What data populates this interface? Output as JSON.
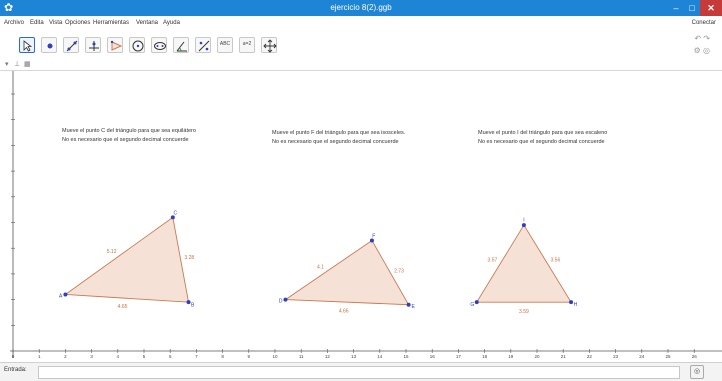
{
  "window": {
    "title": "ejercicio 8(2).ggb",
    "app_icon": "geogebra-icon",
    "minimize_label": "–",
    "maximize_label": "□",
    "close_label": "✕"
  },
  "menu": {
    "items": [
      "Archivo",
      "Edita",
      "Vista",
      "Opciones",
      "Herramientas",
      "Ventana",
      "Ayuda"
    ],
    "connect": "Conectar"
  },
  "toolbar": {
    "tools": [
      "move-tool",
      "point-tool",
      "line-tool",
      "perpendicular-tool",
      "polygon-tool",
      "circle-tool",
      "conic-tool",
      "angle-tool",
      "reflect-tool",
      "text-tool",
      "slider-tool",
      "move-view-tool"
    ],
    "text_tool_label": "ABC",
    "slider_tool_label": "a=2",
    "undo_label": "↶ ↷",
    "help_label": "⚙ ◎"
  },
  "graphics": {
    "style_bar_icons": [
      "style-arrow-icon",
      "axes-icon",
      "grid-icon"
    ],
    "instructions": [
      {
        "line1": "Mueve el punto C del triángulo para que sea equilátero",
        "line2": "No es necesario que el segundo decimal concuerde"
      },
      {
        "line1": "Mueve el punto F del triángulo para que sea isosceles.",
        "line2": "No es necesario que el segundo decimal concuerde"
      },
      {
        "line1": "Mueve el punto I del triángulo para que sea escaleno",
        "line2": "No es necesario que el segundo decimal concuerde"
      }
    ],
    "triangles": [
      {
        "points": [
          {
            "name": "A",
            "x": 2,
            "y": 2.2
          },
          {
            "name": "B",
            "x": 6.7,
            "y": 1.9
          },
          {
            "name": "C",
            "x": 6.1,
            "y": 5.2
          }
        ],
        "sides": [
          "4.65",
          "3.28",
          "5.12"
        ]
      },
      {
        "points": [
          {
            "name": "D",
            "x": 10.4,
            "y": 2.0
          },
          {
            "name": "E",
            "x": 15.1,
            "y": 1.8
          },
          {
            "name": "F",
            "x": 13.7,
            "y": 4.3
          }
        ],
        "sides": [
          "4.66",
          "2.73",
          "4.1"
        ]
      },
      {
        "points": [
          {
            "name": "G",
            "x": 17.7,
            "y": 1.9
          },
          {
            "name": "H",
            "x": 21.3,
            "y": 1.9
          },
          {
            "name": "I",
            "x": 19.5,
            "y": 4.9
          }
        ],
        "sides": [
          "3.59",
          "3.56",
          "3.57"
        ]
      }
    ],
    "x_ticks": [
      "0",
      "1",
      "2",
      "3",
      "4",
      "5",
      "6",
      "7",
      "8",
      "9",
      "10",
      "11",
      "12",
      "13",
      "14",
      "15",
      "16",
      "17",
      "18",
      "19",
      "20",
      "21",
      "22",
      "23",
      "24",
      "25",
      "26"
    ],
    "y_ticks": [
      "1",
      "2",
      "3",
      "4",
      "5",
      "6",
      "7",
      "8",
      "9",
      "10",
      "11"
    ],
    "colors": {
      "fill": "#f6e1d6",
      "edge": "#c87a52",
      "point": "#2f3fbf",
      "label": "#c8713f"
    }
  },
  "input_bar": {
    "label": "Entrada:",
    "value": "",
    "help_icon": "◎"
  }
}
